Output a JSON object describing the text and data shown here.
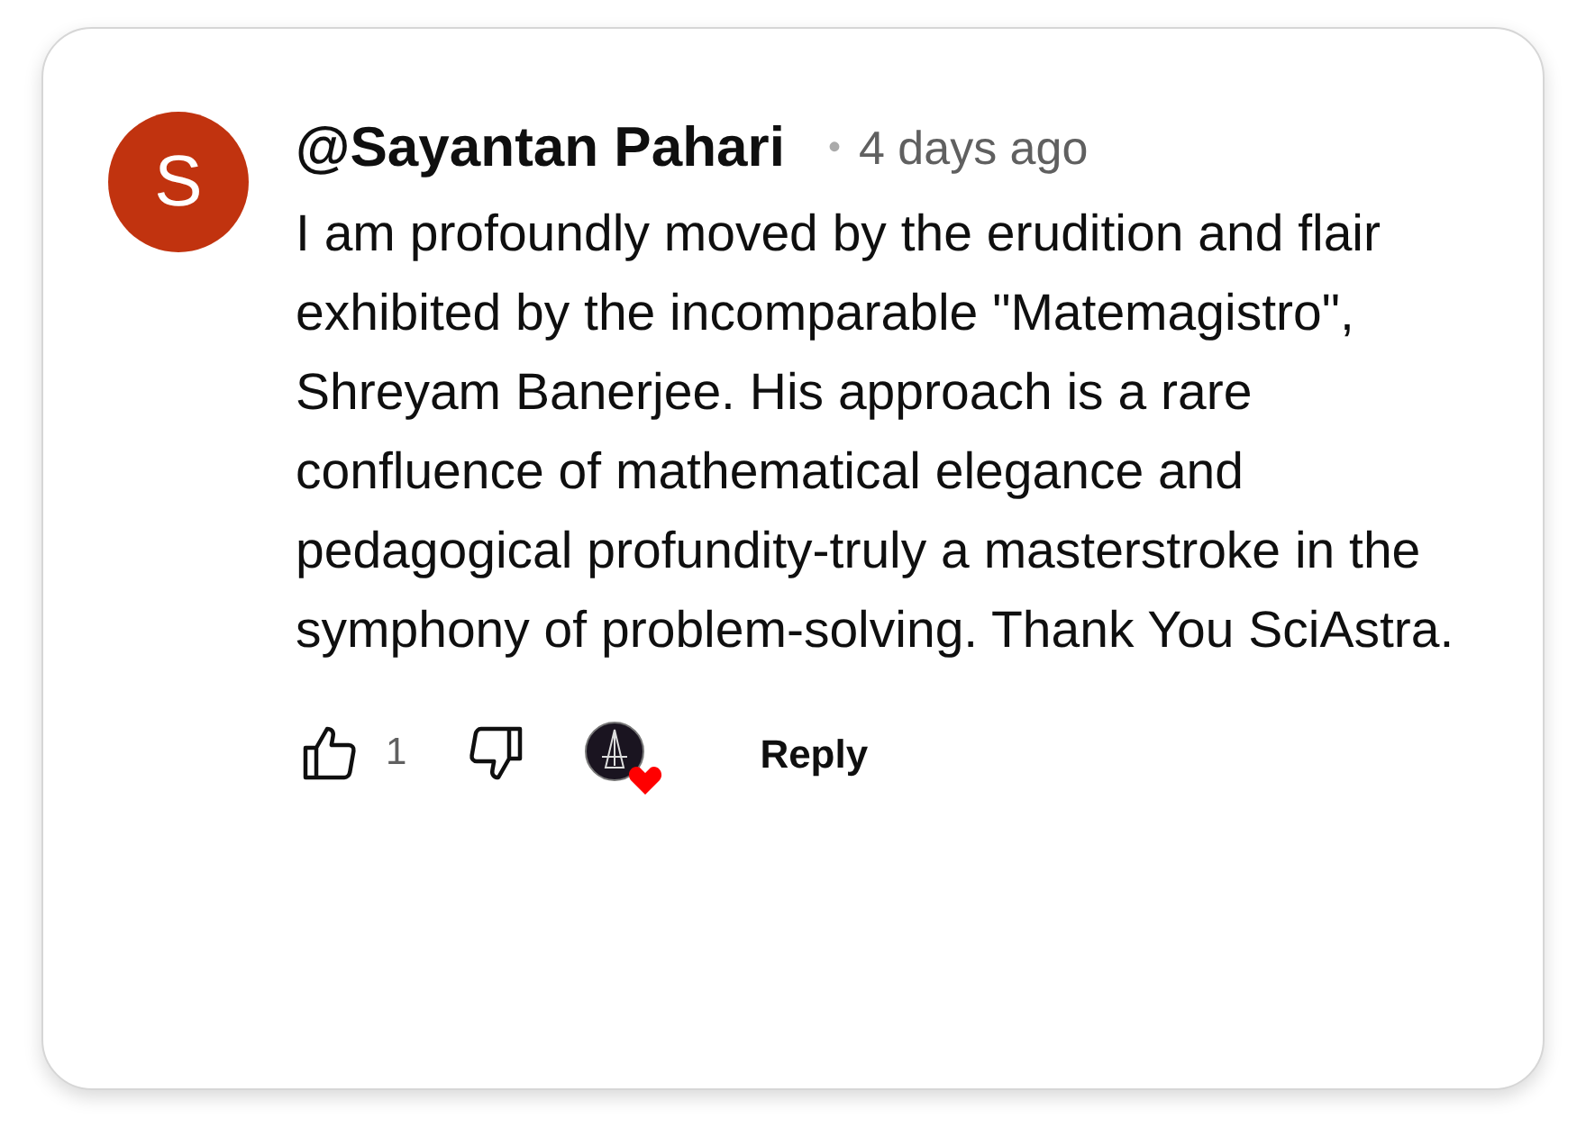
{
  "comment": {
    "avatar_letter": "S",
    "author": "@Sayantan Pahari",
    "separator": "•",
    "time": "4 days ago",
    "text": "I am profoundly moved by the erudition and flair exhibited by the incomparable \"Matemagistro\", Shreyam Banerjee. His approach is a rare confluence of mathematical elegance and pedagogical profundity-truly a masterstroke in the symphony of problem-solving. Thank You SciAstra.",
    "like_count": "1",
    "hearted_by_creator": true,
    "reply_label": "Reply"
  }
}
